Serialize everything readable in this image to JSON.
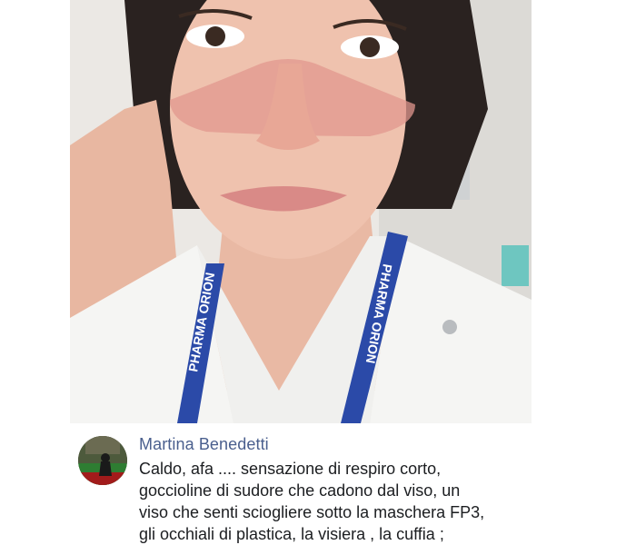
{
  "post": {
    "photo": {
      "icon": "selfie-photo",
      "lanyard_text": "PHARMA ORION"
    },
    "comment": {
      "author": "Martina Benedetti",
      "avatar_icon": "profile-picture",
      "lines": [
        "Caldo, afa .... sensazione di respiro corto,",
        "goccioline di sudore che cadono dal viso, un",
        "viso che senti sciogliere sotto la maschera FP3,",
        "gli occhiali di plastica, la visiera , la cuffia ;"
      ]
    }
  },
  "colors": {
    "author_link": "#4a5f8e",
    "text": "#1c1e21",
    "lanyard": "#2b4aa8",
    "scrubs": "#f4f4f2"
  }
}
